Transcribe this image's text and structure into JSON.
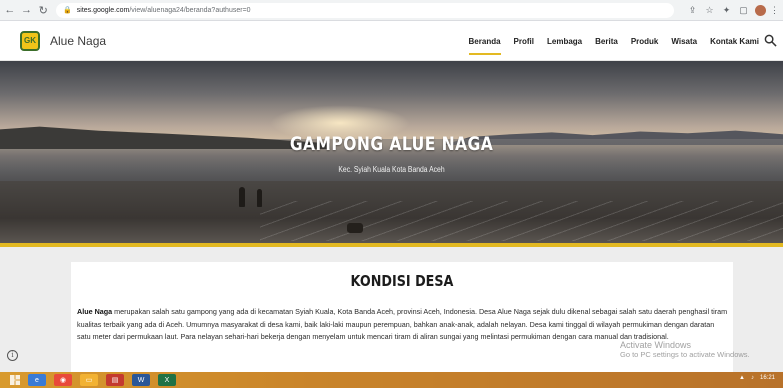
{
  "browser": {
    "url_host": "sites.google.com",
    "url_path": "/view/aluenaga24/beranda?authuser=0"
  },
  "site": {
    "logo_text": "GK",
    "name": "Alue Naga",
    "nav": [
      {
        "label": "Beranda",
        "active": true
      },
      {
        "label": "Profil",
        "active": false
      },
      {
        "label": "Lembaga",
        "active": false
      },
      {
        "label": "Berita",
        "active": false
      },
      {
        "label": "Produk",
        "active": false
      },
      {
        "label": "Wisata",
        "active": false
      },
      {
        "label": "Kontak Kami",
        "active": false
      }
    ]
  },
  "hero": {
    "title": "GAMPONG ALUE NAGA",
    "subtitle": "Kec. Syiah Kuala Kota Banda Aceh"
  },
  "section": {
    "title": "KONDISI DESA",
    "lead": "Alue Naga",
    "body": " merupakan salah satu gampong yang ada di kecamatan Syiah Kuala, Kota Banda Aceh, provinsi Aceh, Indonesia. Desa Alue Naga sejak dulu dikenal sebagai salah satu daerah penghasil tiram kualitas terbaik yang ada di Aceh. Umumnya masyarakat di desa kami, baik laki-laki maupun perempuan, bahkan anak-anak, adalah nelayan. Desa kami tinggal di wilayah permukiman dengan daratan satu meter dari permukaan laut. Para nelayan sehari-hari bekerja dengan menyelam untuk mencari tiram di aliran sungai yang melintasi permukiman dengan cara manual dan tradisional."
  },
  "windows_watermark": {
    "line1": "Activate Windows",
    "line2": "Go to PC settings to activate Windows."
  },
  "taskbar": {
    "time": "16:21"
  },
  "colors": {
    "accent": "#e3b922",
    "taskbar": "#c9842a"
  }
}
